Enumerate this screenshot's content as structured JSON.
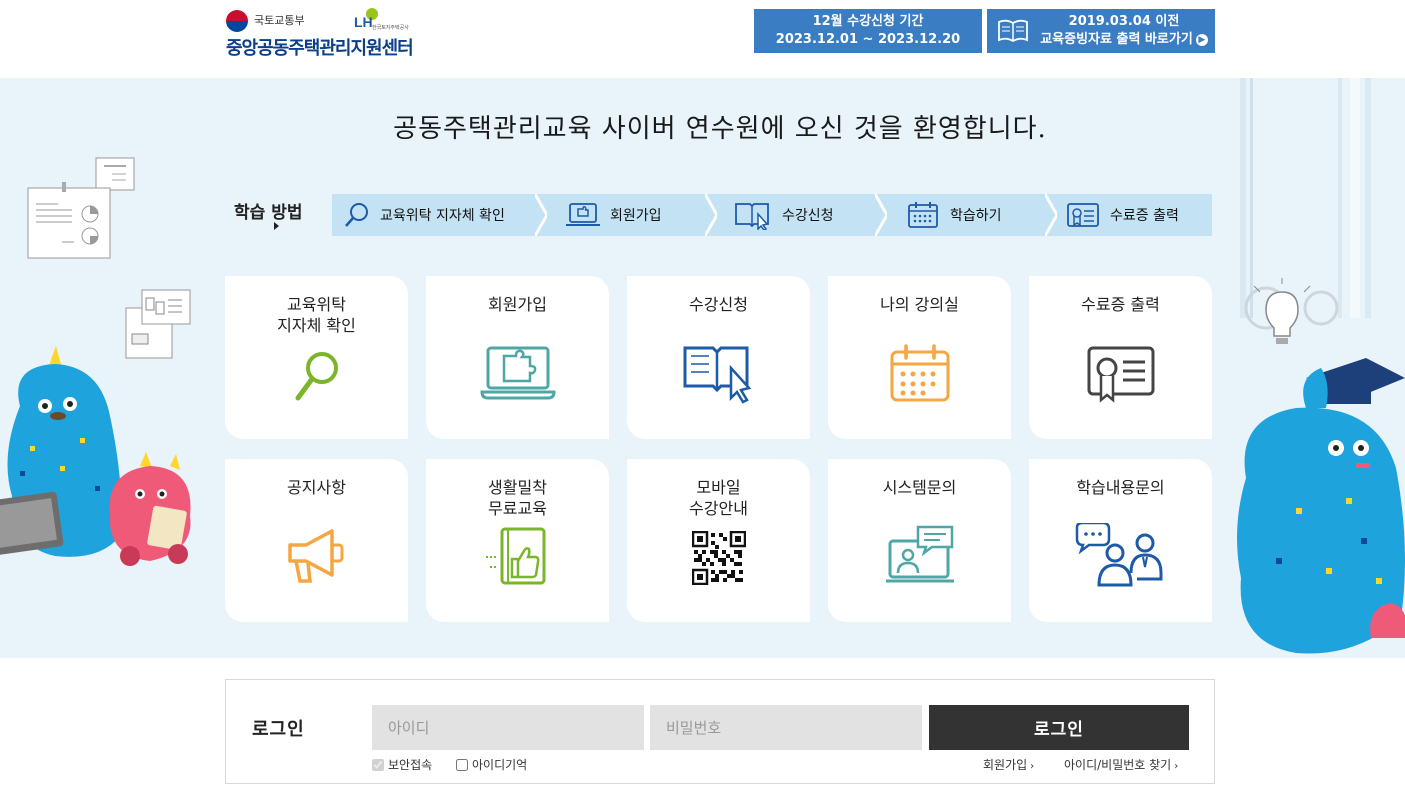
{
  "header": {
    "ministry": "국토교통부",
    "lh_mark": "LH",
    "lh_name": "한국토지주택공사",
    "center_name": "중앙공동주택관리지원센터",
    "period_banner": {
      "line1": "12월 수강신청 기간",
      "line2": "2023.12.01 ~ 2023.12.20"
    },
    "print_banner": {
      "line1": "2019.03.04 이전",
      "line2": "교육증빙자료 출력 바로가기"
    }
  },
  "hero": {
    "welcome": "공동주택관리교육 사이버 연수원에 오신 것을 환영합니다."
  },
  "steps": {
    "title": "학습 방법",
    "items": [
      {
        "label": "교육위탁 지자체 확인",
        "icon": "search-icon"
      },
      {
        "label": "회원가입",
        "icon": "laptop-puzzle-icon"
      },
      {
        "label": "수강신청",
        "icon": "book-cursor-icon"
      },
      {
        "label": "학습하기",
        "icon": "calendar-icon"
      },
      {
        "label": "수료증 출력",
        "icon": "certificate-icon"
      }
    ]
  },
  "cards": [
    {
      "label": "교육위탁\n지자체 확인",
      "icon": "search-icon"
    },
    {
      "label": "회원가입",
      "icon": "laptop-puzzle-icon"
    },
    {
      "label": "수강신청",
      "icon": "book-cursor-icon"
    },
    {
      "label": "나의 강의실",
      "icon": "calendar-icon"
    },
    {
      "label": "수료증 출력",
      "icon": "certificate-icon"
    },
    {
      "label": "공지사항",
      "icon": "megaphone-icon"
    },
    {
      "label": "생활밀착\n무료교육",
      "icon": "thumbs-up-book-icon"
    },
    {
      "label": "모바일\n수강안내",
      "icon": "qr-code-icon"
    },
    {
      "label": "시스템문의",
      "icon": "video-chat-icon"
    },
    {
      "label": "학습내용문의",
      "icon": "consultation-icon"
    }
  ],
  "colors": {
    "banner_blue": "#3b7dc3",
    "hero_bg": "#e8f3fa",
    "steps_bg": "#c3e2f3",
    "icon_green": "#7bb52a",
    "icon_teal": "#4fa6a6",
    "icon_blue": "#3b7dc3",
    "icon_orange": "#f5a640",
    "icon_dark": "#444444"
  },
  "login": {
    "title": "로그인",
    "id_placeholder": "아이디",
    "pw_placeholder": "비밀번호",
    "button": "로그인",
    "secure_label": "보안접속",
    "remember_label": "아이디기억",
    "signup_link": "회원가입",
    "find_link": "아이디/비밀번호 찾기"
  }
}
